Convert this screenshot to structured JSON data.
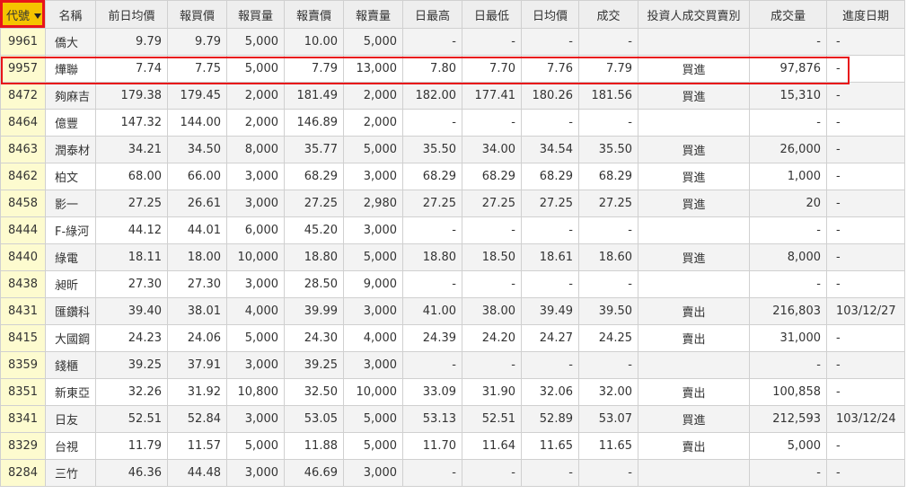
{
  "colors": {
    "header_bg": "#eeeeee",
    "sort_header_bg": "#f5c400",
    "code_cell_bg": "#fdfbcf",
    "highlight": "#e8141a"
  },
  "columns": [
    "代號",
    "名稱",
    "前日均價",
    "報買價",
    "報買量",
    "報賣價",
    "報賣量",
    "日最高",
    "日最低",
    "日均價",
    "成交",
    "投資人成交買賣別",
    "成交量",
    "進度日期"
  ],
  "rows": [
    [
      "9961",
      "僑大",
      "9.79",
      "9.79",
      "5,000",
      "10.00",
      "5,000",
      "-",
      "-",
      "-",
      "-",
      "",
      "-",
      "-"
    ],
    [
      "9957",
      "燁聯",
      "7.74",
      "7.75",
      "5,000",
      "7.79",
      "13,000",
      "7.80",
      "7.70",
      "7.76",
      "7.79",
      "買進",
      "97,876",
      "-"
    ],
    [
      "8472",
      "夠麻吉",
      "179.38",
      "179.45",
      "2,000",
      "181.49",
      "2,000",
      "182.00",
      "177.41",
      "180.26",
      "181.56",
      "買進",
      "15,310",
      "-"
    ],
    [
      "8464",
      "億豐",
      "147.32",
      "144.00",
      "2,000",
      "146.89",
      "2,000",
      "-",
      "-",
      "-",
      "-",
      "",
      "-",
      "-"
    ],
    [
      "8463",
      "潤泰材",
      "34.21",
      "34.50",
      "8,000",
      "35.77",
      "5,000",
      "35.50",
      "34.00",
      "34.54",
      "35.50",
      "買進",
      "26,000",
      "-"
    ],
    [
      "8462",
      "柏文",
      "68.00",
      "66.00",
      "3,000",
      "68.29",
      "3,000",
      "68.29",
      "68.29",
      "68.29",
      "68.29",
      "買進",
      "1,000",
      "-"
    ],
    [
      "8458",
      "影一",
      "27.25",
      "26.61",
      "3,000",
      "27.25",
      "2,980",
      "27.25",
      "27.25",
      "27.25",
      "27.25",
      "買進",
      "20",
      "-"
    ],
    [
      "8444",
      "F-綠河",
      "44.12",
      "44.01",
      "6,000",
      "45.20",
      "3,000",
      "-",
      "-",
      "-",
      "-",
      "",
      "-",
      "-"
    ],
    [
      "8440",
      "綠電",
      "18.11",
      "18.00",
      "10,000",
      "18.80",
      "5,000",
      "18.80",
      "18.50",
      "18.61",
      "18.60",
      "買進",
      "8,000",
      "-"
    ],
    [
      "8438",
      "昶昕",
      "27.30",
      "27.30",
      "3,000",
      "28.50",
      "9,000",
      "-",
      "-",
      "-",
      "-",
      "",
      "-",
      "-"
    ],
    [
      "8431",
      "匯鑽科",
      "39.40",
      "38.01",
      "4,000",
      "39.99",
      "3,000",
      "41.00",
      "38.00",
      "39.49",
      "39.50",
      "賣出",
      "216,803",
      "103/12/27"
    ],
    [
      "8415",
      "大國鋼",
      "24.23",
      "24.06",
      "5,000",
      "24.30",
      "4,000",
      "24.39",
      "24.20",
      "24.27",
      "24.25",
      "賣出",
      "31,000",
      "-"
    ],
    [
      "8359",
      "錢櫃",
      "39.25",
      "37.91",
      "3,000",
      "39.25",
      "3,000",
      "-",
      "-",
      "-",
      "-",
      "",
      "-",
      "-"
    ],
    [
      "8351",
      "新東亞",
      "32.26",
      "31.92",
      "10,800",
      "32.50",
      "10,000",
      "33.09",
      "31.90",
      "32.06",
      "32.00",
      "賣出",
      "100,858",
      "-"
    ],
    [
      "8341",
      "日友",
      "52.51",
      "52.84",
      "3,000",
      "53.05",
      "5,000",
      "53.13",
      "52.51",
      "52.89",
      "53.07",
      "買進",
      "212,593",
      "103/12/24"
    ],
    [
      "8329",
      "台視",
      "11.79",
      "11.57",
      "5,000",
      "11.88",
      "5,000",
      "11.70",
      "11.64",
      "11.65",
      "11.65",
      "賣出",
      "5,000",
      "-"
    ],
    [
      "8284",
      "三竹",
      "46.36",
      "44.48",
      "3,000",
      "46.69",
      "3,000",
      "-",
      "-",
      "-",
      "-",
      "",
      "-",
      "-"
    ]
  ],
  "sort_icon": "caret-down-icon"
}
